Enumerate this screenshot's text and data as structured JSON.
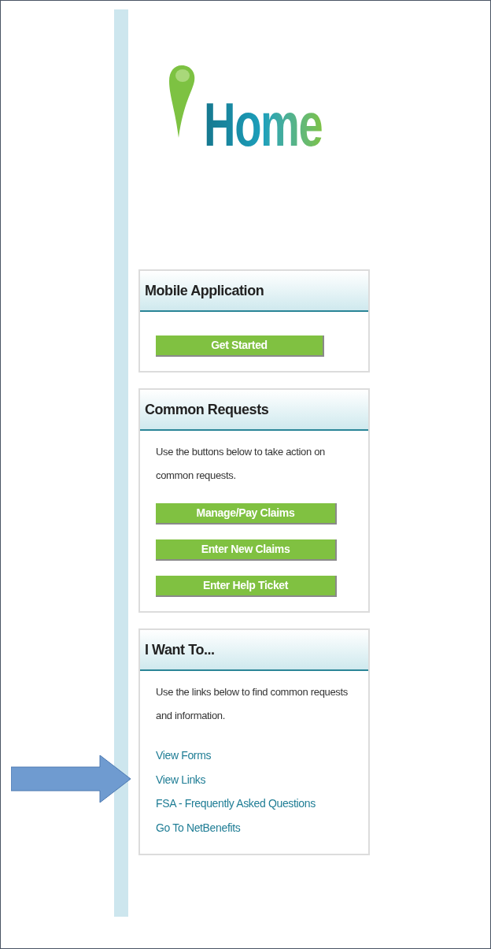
{
  "logo": {
    "text": "Home"
  },
  "sections": [
    {
      "title": "Mobile Application",
      "buttons": [
        "Get Started"
      ]
    },
    {
      "title": "Common Requests",
      "description": "Use the buttons below to take action on common requests.",
      "buttons": [
        "Manage/Pay Claims",
        "Enter New Claims",
        "Enter Help Ticket"
      ]
    },
    {
      "title": "I Want To...",
      "description": "Use the links below to find common requests and information.",
      "links": [
        "View Forms",
        "View Links",
        "FSA - Frequently Asked Questions",
        "Go To NetBenefits"
      ]
    }
  ]
}
